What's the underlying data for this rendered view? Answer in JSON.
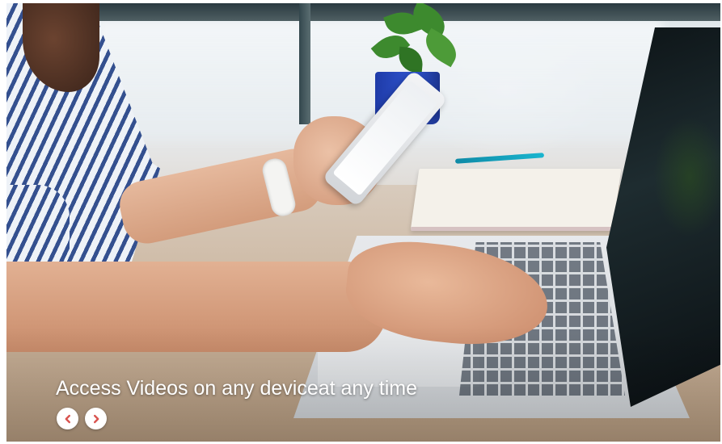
{
  "slide": {
    "caption": "Access Videos on any deviceat any time"
  },
  "controls": {
    "prev_icon": "chevron-left-icon",
    "next_icon": "chevron-right-icon",
    "icon_color": "#d9534f",
    "button_bg": "#ffffff"
  }
}
